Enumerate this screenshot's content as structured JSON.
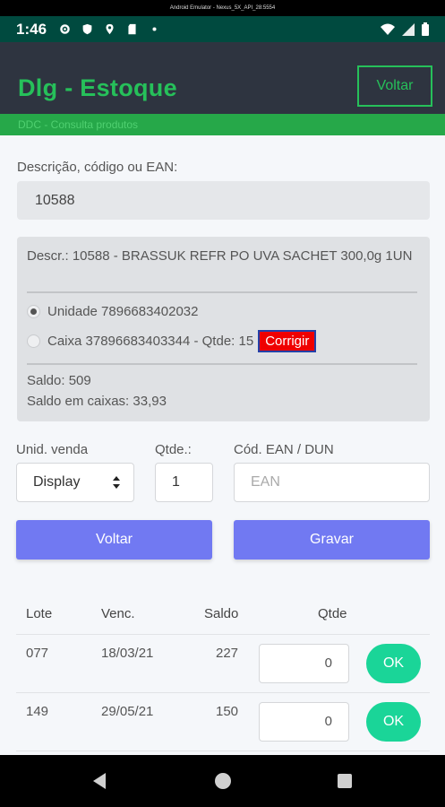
{
  "emulator": {
    "title": "Android Emulator - Nexus_5X_API_28:5554"
  },
  "status_bar": {
    "time": "1:46"
  },
  "header": {
    "title": "Dlg - Estoque",
    "back_label": "Voltar",
    "breadcrumb": "DDC - Consulta produtos"
  },
  "search": {
    "label": "Descrição, código ou EAN:",
    "value": "10588"
  },
  "product": {
    "description": "Descr.: 10588 - BRASSUK REFR PO UVA SACHET 300,0g 1UN",
    "unit_option": "Unidade 7896683402032",
    "box_option": "Caixa 37896683403344 - Qtde: 15",
    "fix_label": "Corrigir",
    "saldo": "Saldo: 509",
    "saldo_caixas": "Saldo em caixas: 33,93"
  },
  "form": {
    "unit_label": "Unid. venda",
    "unit_value": "Display",
    "qty_label": "Qtde.:",
    "qty_value": "1",
    "ean_label": "Cód. EAN / DUN",
    "ean_placeholder": "EAN",
    "back_button": "Voltar",
    "save_button": "Gravar"
  },
  "table": {
    "headers": {
      "lote": "Lote",
      "venc": "Venc.",
      "saldo": "Saldo",
      "qtde": "Qtde"
    },
    "rows": [
      {
        "lote": "077",
        "venc": "18/03/21",
        "saldo": "227",
        "qtde": "0",
        "ok": "OK"
      },
      {
        "lote": "149",
        "venc": "29/05/21",
        "saldo": "150",
        "qtde": "0",
        "ok": "OK"
      }
    ]
  },
  "colors": {
    "accent_green": "#26c05a",
    "header_bg": "#2e3440",
    "primary_button": "#7179f2",
    "ok_button": "#1ad598",
    "fix_button": "#ef0000"
  }
}
